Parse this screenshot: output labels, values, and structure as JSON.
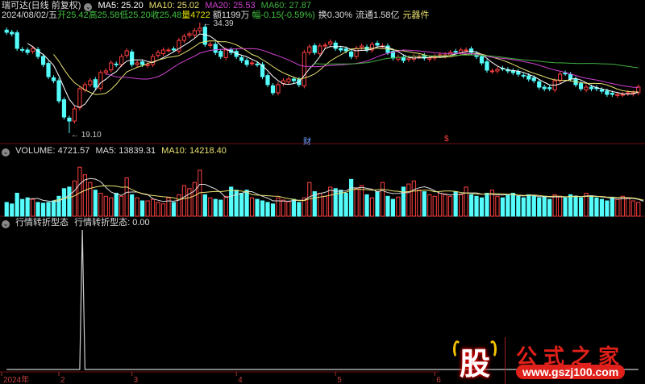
{
  "header": {
    "stock_name": "瑞可达(日线 前复权)",
    "ma5": "MA5: 25.20",
    "ma10": "MA10: 25.02",
    "ma20": "MA20: 25.53",
    "ma60": "MA60: 27.87",
    "date": "2024/08/02/五",
    "open": "开25.42",
    "high": "高25.58",
    "low": "低25.20",
    "close": "收25.48",
    "vol": "量4722",
    "amount": "额1199万",
    "change": "幅-0.15(-0.59%)",
    "turnover": "换0.30%",
    "float": "流通1.58亿",
    "sector": "元器件"
  },
  "volume_header": {
    "title": "VOLUME: 4721.57",
    "ma5": "MA5: 13839.31",
    "ma10": "MA10: 14218.40"
  },
  "indicator_header": {
    "title": "行情转折型态",
    "value": "行情转折型态: 0.00"
  },
  "markers": {
    "cai": "财",
    "dollar": "$"
  },
  "logo": {
    "char": "股",
    "name": "公式之家",
    "url": "www.gszj100.com"
  },
  "colors": {
    "up": "#ff4040",
    "down": "#54fcfc",
    "ma5": "#ffffff",
    "ma10": "#e8e070",
    "ma20": "#d040d0",
    "ma60": "#40b040"
  },
  "chart_data": {
    "type": "candlestick",
    "price_range": [
      19.1,
      34.39
    ],
    "extremes": {
      "high": {
        "label": "34.39",
        "value": 34.39,
        "index": 37
      },
      "low": {
        "label": "19.10",
        "value": 19.1,
        "index": 12
      }
    },
    "closes": [
      33.05,
      32.83,
      30.82,
      30.6,
      30.26,
      30.82,
      29.7,
      28.59,
      26.91,
      26.35,
      23.56,
      21.33,
      20.77,
      22.45,
      25.24,
      25.8,
      26.35,
      25.46,
      27.47,
      27.7,
      28.81,
      28.59,
      29.7,
      30.48,
      28.59,
      28.81,
      28.59,
      28.59,
      29.7,
      30.26,
      30.6,
      30.6,
      30.6,
      31.93,
      32.49,
      32.83,
      33.27,
      33.61,
      31.38,
      31.38,
      30.26,
      29.7,
      30.6,
      30.26,
      29.7,
      29.15,
      28.59,
      28.81,
      28.59,
      26.91,
      25.8,
      24.68,
      25.8,
      26.35,
      26.58,
      26.35,
      25.8,
      30.26,
      31.04,
      30.26,
      31.15,
      31.27,
      31.71,
      30.82,
      30.6,
      30.48,
      29.7,
      30.82,
      31.15,
      30.6,
      31.38,
      31.27,
      31.15,
      30.26,
      29.48,
      29.6,
      29.15,
      29.48,
      29.7,
      29.7,
      29.48,
      29.48,
      29.7,
      29.93,
      29.93,
      30.26,
      30.37,
      30.6,
      30.6,
      30.26,
      29.7,
      28.81,
      27.81,
      27.7,
      27.92,
      28.03,
      27.7,
      27.47,
      27.25,
      27.02,
      26.58,
      26.35,
      25.46,
      25.24,
      25.24,
      26.35,
      27.25,
      27.36,
      26.58,
      25.8,
      25.24,
      25.46,
      25.24,
      25.24,
      24.9,
      24.46,
      24.46,
      24.46,
      24.46,
      24.68,
      24.68,
      25.48
    ],
    "volumes": [
      9000,
      8000,
      15000,
      11000,
      12000,
      11000,
      9000,
      8500,
      9000,
      10000,
      13000,
      18000,
      19000,
      23000,
      32000,
      27000,
      22000,
      17000,
      15000,
      13000,
      12000,
      15000,
      13000,
      25000,
      14000,
      12000,
      10000,
      10000,
      11000,
      9000,
      8000,
      12000,
      9000,
      14000,
      20000,
      18000,
      22000,
      30000,
      14000,
      12000,
      11000,
      10500,
      13000,
      19000,
      17000,
      15000,
      17000,
      12000,
      11000,
      10000,
      9000,
      8000,
      12000,
      10500,
      9500,
      11000,
      9000,
      12000,
      22000,
      16000,
      15000,
      13000,
      19000,
      18000,
      17000,
      15000,
      24000,
      18000,
      20000,
      14000,
      12000,
      16000,
      22000,
      13000,
      11000,
      12500,
      19000,
      21000,
      23000,
      17000,
      16000,
      14000,
      13000,
      15000,
      14000,
      13000,
      16000,
      14000,
      19000,
      14000,
      13000,
      12000,
      15000,
      17000,
      13000,
      12000,
      14000,
      15000,
      13000,
      12000,
      14000,
      13000,
      12000,
      13000,
      11000,
      14000,
      13000,
      12000,
      14000,
      13000,
      12000,
      15000,
      13000,
      12000,
      11000,
      10000,
      12000,
      11000,
      13000,
      12000,
      10000,
      9000,
      4722
    ],
    "volume_max": 40000,
    "indicator": {
      "signal_indices": [
        14
      ],
      "range": [
        0,
        1
      ]
    },
    "x_labels": [
      {
        "text": "2024年",
        "index": 0
      },
      {
        "text": "2",
        "index": 10
      },
      {
        "text": "3",
        "index": 24
      },
      {
        "text": "4",
        "index": 44
      },
      {
        "text": "5",
        "index": 63
      },
      {
        "text": "6",
        "index": 82
      }
    ]
  }
}
